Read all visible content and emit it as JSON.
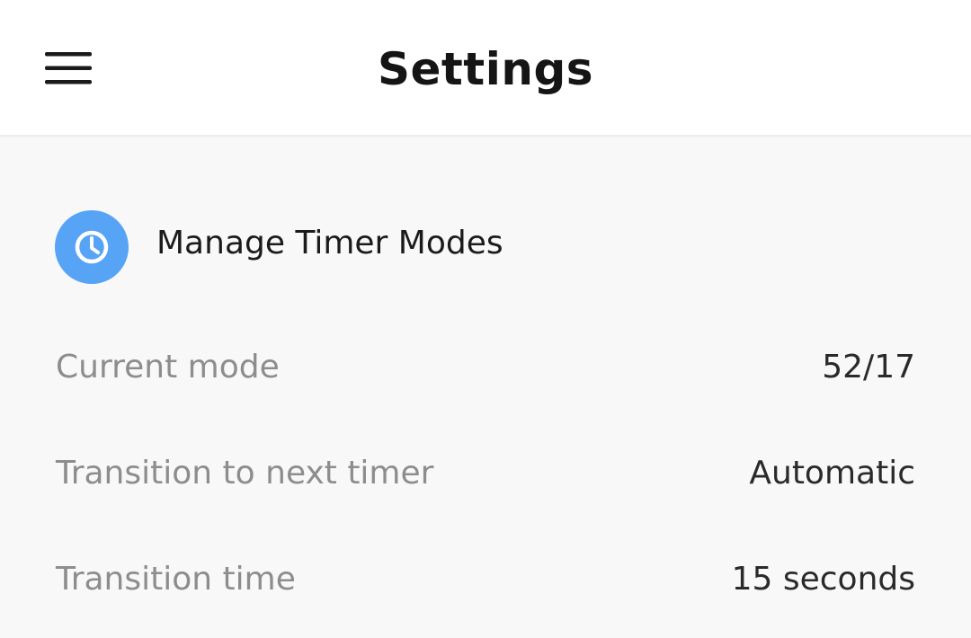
{
  "header": {
    "title": "Settings",
    "menu_icon": "hamburger-menu-icon"
  },
  "manage_timer_modes": {
    "label": "Manage Timer Modes",
    "icon": "clock-icon",
    "icon_bg_color": "#57a4f6"
  },
  "settings": [
    {
      "label": "Current mode",
      "value": "52/17"
    },
    {
      "label": "Transition to next timer",
      "value": "Automatic"
    },
    {
      "label": "Transition time",
      "value": "15 seconds"
    }
  ]
}
